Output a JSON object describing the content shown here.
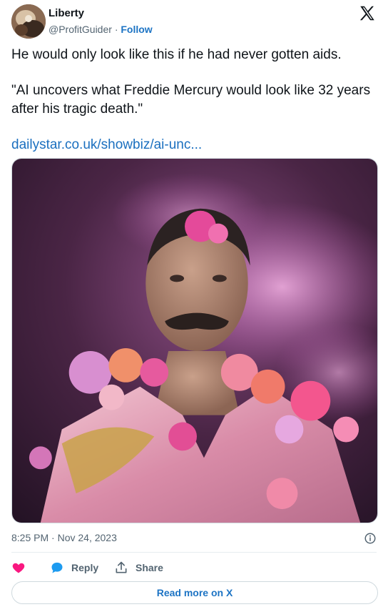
{
  "author": {
    "display_name": "Liberty",
    "handle": "@ProfitGuider",
    "separator": "·",
    "follow_label": "Follow"
  },
  "tweet": {
    "line1": "He would only look like this if he had never gotten aids.",
    "line2": "\"AI uncovers what Freddie Mercury would look like 32 years after his tragic death.\"",
    "link_text": "dailystar.co.uk/showbiz/ai-unc..."
  },
  "meta": {
    "timestamp": "8:25 PM · Nov 24, 2023"
  },
  "actions": {
    "like_icon": "heart-icon",
    "reply_label": "Reply",
    "share_label": "Share"
  },
  "read_more_label": "Read more on X",
  "colors": {
    "link": "#1a6fbf",
    "like": "#f91880",
    "reply": "#1d9bf0",
    "muted": "#536471"
  }
}
